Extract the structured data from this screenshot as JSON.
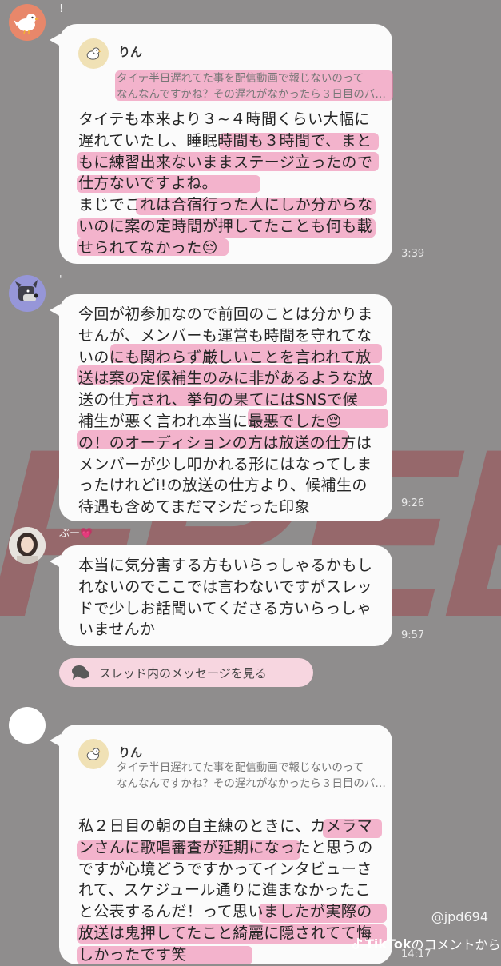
{
  "messages": [
    {
      "name_mark": "!",
      "quote": {
        "name": "りん",
        "text": "タイテ半日遅れてた事を配信動画で報じないのって\nなんなんですかね？その遅れがなかったら３日目のバ…"
      },
      "text": "タイテも本来より３~４時間くらい大幅に\n遅れていたし、睡眠時間も３時間で、まと\nもに練習出来ないままステージ立ったので\n仕方ないですよね。\nまじでこれは合宿行った人にしか分からな\nいのに案の定時間が押してたことも何も載\nせられてなかった😔",
      "time": "3:39",
      "avatar_icon": "bird-icon"
    },
    {
      "name_mark": "'",
      "text": "今回が初参加なので前回のことは分かりま\nせんが、メンバーも運営も時間を守れてな\nいのにも関わらず厳しいことを言われて放\n送は案の定候補生のみに非があるような放\n送の仕方され、挙句の果てにはSNSで候\n補生が悪く言われ本当に最悪でした😔\nの！のオーディションの方は放送の仕方は\nメンバーが少し叩かれる形にはなってしま\nったけれどi!の放送の仕方より、候補生の\n待遇も含めてまだマシだった印象",
      "time": "9:26",
      "avatar_icon": "dog-icon"
    },
    {
      "name_mark": "ぶー💗",
      "text": "本当に気分害する方もいらっしゃるかもし\nれないのでここでは言わないですがスレッ\nドで少しお話聞いてくださる方いらっしゃ\nいませんか",
      "time": "9:57",
      "avatar_icon": "girl-photo-icon"
    },
    {
      "name_mark": "",
      "quote": {
        "name": "りん",
        "text": "タイテ半日遅れてた事を配信動画で報じないのって\nなんなんですかね？その遅れがなかったら３日目のバ…"
      },
      "text": "私２日目の朝の自主練のときに、カメラマ\nンさんに歌唱審査が延期になったと思うの\nですが心境どうですかってインタビューさ\nれて、スケジュール通りに進まなかったこ\nと公表するんだ！って思いましたが実際の\n放送は鬼押してたこと綺麗に隠されてて悔\nしかったです笑",
      "time": "14:17",
      "avatar_icon": "blank-avatar-icon"
    }
  ],
  "thread_button": {
    "label": "スレッド内のメッセージを見る",
    "icon": "speech-bubble-icon"
  },
  "watermark": "FREE!",
  "credit": "@jpd694",
  "tiktok": {
    "brand": "TikTok",
    "suffix": "のコメントから",
    "icon": "tiktok-icon"
  },
  "colors": {
    "background": "#8f8d8d",
    "bubble": "#fbfbfb",
    "highlight": "#ec78a5",
    "thread_button": "#f7d6e0"
  }
}
